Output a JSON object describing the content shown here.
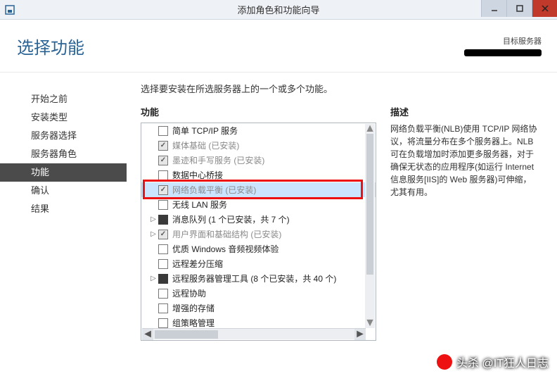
{
  "window": {
    "title": "添加角色和功能向导"
  },
  "header": {
    "page_title": "选择功能",
    "dest_label": "目标服务器",
    "dest_value": "(已涂黑)"
  },
  "nav": {
    "items": [
      {
        "label": "开始之前"
      },
      {
        "label": "安装类型"
      },
      {
        "label": "服务器选择"
      },
      {
        "label": "服务器角色"
      },
      {
        "label": "功能",
        "selected": true
      },
      {
        "label": "确认"
      },
      {
        "label": "结果"
      }
    ]
  },
  "main": {
    "instruction": "选择要安装在所选服务器上的一个或多个功能。",
    "features_heading": "功能",
    "desc_heading": "描述",
    "desc_text": "网络负载平衡(NLB)使用 TCP/IP 网络协议，将流量分布在多个服务器上。NLB 可在负载增加时添加更多服务器，对于确保无状态的应用程序(如运行 Internet 信息服务[IIS]的 Web 服务器)可伸缩，尤其有用。",
    "features": [
      {
        "label": "简单 TCP/IP 服务",
        "state": "unchecked",
        "expander": "none"
      },
      {
        "label": "媒体基础 (已安装)",
        "state": "checked-disabled",
        "expander": "none"
      },
      {
        "label": "墨迹和手写服务 (已安装)",
        "state": "checked-disabled",
        "expander": "none"
      },
      {
        "label": "数据中心桥接",
        "state": "unchecked",
        "expander": "none"
      },
      {
        "label": "网络负载平衡 (已安装)",
        "state": "checked-disabled",
        "expander": "none",
        "selected": true,
        "highlighted": true
      },
      {
        "label": "无线 LAN 服务",
        "state": "unchecked",
        "expander": "none"
      },
      {
        "label": "消息队列 (1 个已安装，共 7 个)",
        "state": "filled",
        "expander": "collapsed"
      },
      {
        "label": "用户界面和基础结构 (已安装)",
        "state": "checked-disabled",
        "expander": "collapsed"
      },
      {
        "label": "优质 Windows 音频视频体验",
        "state": "unchecked",
        "expander": "none"
      },
      {
        "label": "远程差分压缩",
        "state": "unchecked",
        "expander": "none"
      },
      {
        "label": "远程服务器管理工具 (8 个已安装，共 40 个)",
        "state": "filled",
        "expander": "collapsed"
      },
      {
        "label": "远程协助",
        "state": "unchecked",
        "expander": "none"
      },
      {
        "label": "增强的存储",
        "state": "unchecked",
        "expander": "none"
      },
      {
        "label": "组策略管理",
        "state": "unchecked",
        "expander": "none"
      }
    ]
  },
  "watermark": "头杀 @IT狂人日志"
}
